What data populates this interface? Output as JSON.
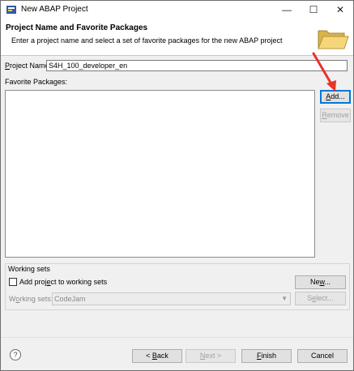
{
  "window": {
    "title": "New ABAP Project"
  },
  "titlebar_buttons": {
    "minimize": "—",
    "maximize": "☐",
    "close": "✕"
  },
  "header": {
    "title": "Project Name and Favorite Packages",
    "description": "Enter a project name and select a set of favorite packages for the new ABAP project"
  },
  "project": {
    "label_underlined": "P",
    "label_rest": "roject Name:",
    "value": "S4H_100_developer_en"
  },
  "favorites": {
    "label": "Favorite Packages:"
  },
  "buttons": {
    "add_underlined": "A",
    "add_rest": "dd...",
    "remove_underlined": "R",
    "remove_rest": "emove"
  },
  "working_sets": {
    "group_label": "Working sets",
    "checkbox_pre": "Add proj",
    "checkbox_underlined": "e",
    "checkbox_post": "ct to working sets",
    "new_pre": "Ne",
    "new_underlined": "w",
    "new_post": "...",
    "sets_label_pre": "W",
    "sets_label_underlined": "o",
    "sets_label_post": "rking sets:",
    "combo_value": "CodeJam",
    "select_pre": "S",
    "select_underlined": "e",
    "select_post": "lect..."
  },
  "footer": {
    "help": "?",
    "back_pre": "< ",
    "back_underlined": "B",
    "back_post": "ack",
    "next_pre": "",
    "next_underlined": "N",
    "next_post": "ext >",
    "finish_pre": "",
    "finish_underlined": "F",
    "finish_post": "inish",
    "cancel": "Cancel"
  }
}
